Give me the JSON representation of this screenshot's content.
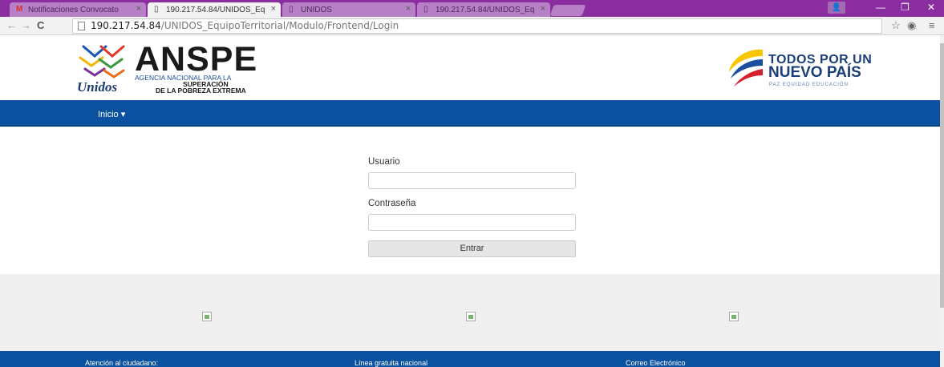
{
  "browser": {
    "tabs": [
      {
        "label": "Notificaciones Convocato",
        "favicon": "gmail-icon"
      },
      {
        "label": "190.217.54.84/UNIDOS_Eq",
        "favicon": "page-icon"
      },
      {
        "label": "UNIDOS",
        "favicon": "page-icon"
      },
      {
        "label": "190.217.54.84/UNIDOS_Eq",
        "favicon": "page-icon"
      }
    ],
    "url_host": "190.217.54.84",
    "url_path": "/UNIDOS_EquipoTerritorial/Modulo/Frontend/Login",
    "tab_close": "×",
    "win_min": "—",
    "win_restore": "❐",
    "win_close": "✕",
    "back": "←",
    "forward": "→",
    "reload": "C",
    "star": "☆",
    "ext": "◉",
    "menu": "≡",
    "profile": "👤"
  },
  "header": {
    "anspe_title": "ANSPE",
    "anspe_line1": "AGENCIA NACIONAL PARA LA",
    "anspe_line2": "SUPERACIÓN",
    "anspe_line3": "DE LA POBREZA EXTREMA",
    "unidos": "Unidos",
    "todos_line1": "TODOS POR UN",
    "todos_line2": "NUEVO PAÍS",
    "todos_line3": "PAZ  EQUIDAD  EDUCACIÓN"
  },
  "nav": {
    "inicio": "Inicio ▾"
  },
  "login": {
    "user_label": "Usuario",
    "user_value": "",
    "pass_label": "Contraseña",
    "pass_value": "",
    "submit": "Entrar"
  },
  "footer": {
    "col1": "Atención al ciudadano:",
    "col2": "Línea gratuita nacional",
    "col3": "Correo Electrónico"
  },
  "colors": {
    "navbar": "#0a52a0",
    "tabbar": "#8a2d9e"
  }
}
